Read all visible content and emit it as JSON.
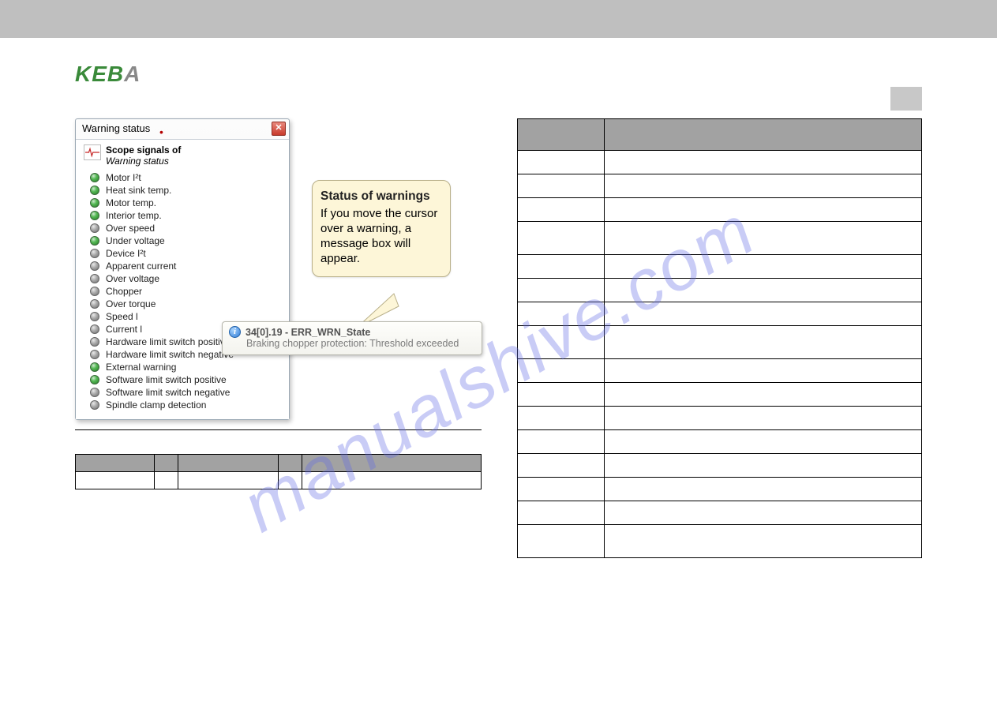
{
  "logo": {
    "main": "KEB",
    "last": "A"
  },
  "watermark": "manualshive.com",
  "warning_window": {
    "title": "Warning status",
    "close": "✕",
    "scope_header": "Scope signals of",
    "scope_sub": "Warning status",
    "signals": [
      {
        "label": "Motor I²t",
        "active": true
      },
      {
        "label": "Heat sink temp.",
        "active": true
      },
      {
        "label": "Motor temp.",
        "active": true
      },
      {
        "label": "Interior temp.",
        "active": true
      },
      {
        "label": "Over speed",
        "active": false
      },
      {
        "label": "Under voltage",
        "active": true
      },
      {
        "label": "Device I²t",
        "active": false
      },
      {
        "label": "Apparent current",
        "active": false
      },
      {
        "label": "Over voltage",
        "active": false
      },
      {
        "label": "Chopper",
        "active": false
      },
      {
        "label": "Over torque",
        "active": false
      },
      {
        "label": "Speed l",
        "active": false
      },
      {
        "label": "Current l",
        "active": false
      },
      {
        "label": "Hardware limit switch positive",
        "active": false
      },
      {
        "label": "Hardware limit switch negative",
        "active": false
      },
      {
        "label": "External warning",
        "active": true
      },
      {
        "label": "Software limit switch positive",
        "active": true
      },
      {
        "label": "Software limit switch negative",
        "active": false
      },
      {
        "label": "Spindle clamp detection",
        "active": false
      }
    ]
  },
  "callout": {
    "heading": "Status of warnings",
    "body": "If you move the cursor over a warning, a message box will appear."
  },
  "tooltip": {
    "title": "34[0].19 - ERR_WRN_State",
    "body": "Braking chopper protection:  Threshold exceeded"
  }
}
